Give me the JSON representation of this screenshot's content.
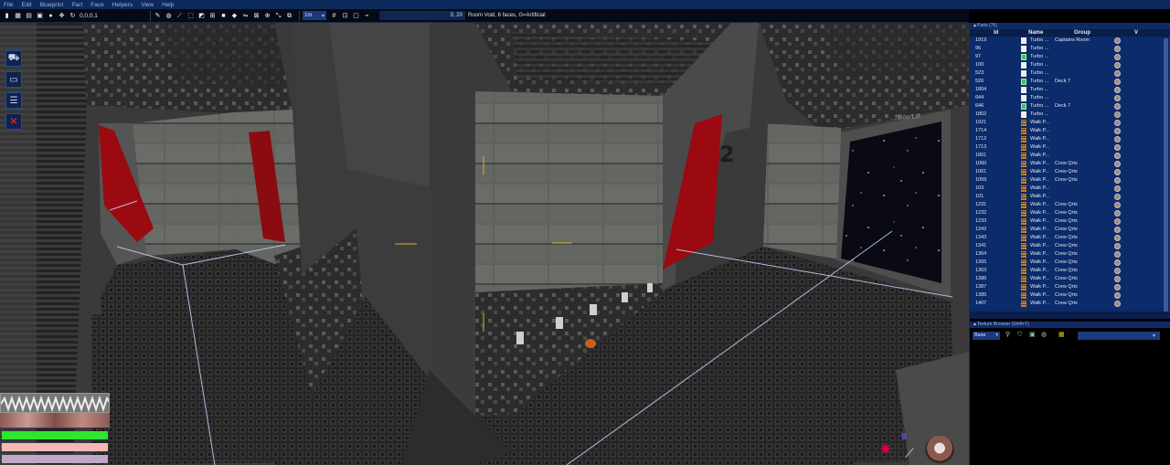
{
  "menu": [
    "File",
    "Edit",
    "Blueprint",
    "Part",
    "Face",
    "Helpers",
    "View",
    "Help"
  ],
  "toolbar": {
    "coords": "0,0,0.1",
    "unit": "1m",
    "readout": "0, 20",
    "status": "Room Void, 6 faces, G=Artificial"
  },
  "viewport": {
    "sign_label": "Turbo Lift",
    "deck_number": "2",
    "hud_number": "8"
  },
  "parts_panel": {
    "title": "Parts (76)",
    "columns": [
      "Id",
      "Name",
      "Group",
      "V"
    ],
    "rows": [
      {
        "id": "1919",
        "name": "Turbo ...",
        "group": "Captains Room",
        "icon": "turbo-white"
      },
      {
        "id": "96",
        "name": "Turbo ...",
        "group": "",
        "icon": "turbo-white"
      },
      {
        "id": "97",
        "name": "Turbo ...",
        "group": "",
        "icon": "turbo-green"
      },
      {
        "id": "100",
        "name": "Turbo ...",
        "group": "",
        "icon": "turbo-white"
      },
      {
        "id": "523",
        "name": "Turbo ...",
        "group": "",
        "icon": "turbo-white"
      },
      {
        "id": "526",
        "name": "Turbo ...",
        "group": "Deck 7",
        "icon": "turbo-green"
      },
      {
        "id": "1804",
        "name": "Turbo ...",
        "group": "",
        "icon": "turbo-white"
      },
      {
        "id": "644",
        "name": "Turbo ...",
        "group": "",
        "icon": "turbo-white"
      },
      {
        "id": "646",
        "name": "Turbo ...",
        "group": "Deck 7",
        "icon": "turbo-green"
      },
      {
        "id": "1802",
        "name": "Turbo ...",
        "group": "",
        "icon": "turbo-white"
      },
      {
        "id": "1921",
        "name": "Walk P...",
        "group": "",
        "icon": "walk"
      },
      {
        "id": "1714",
        "name": "Walk P...",
        "group": "",
        "icon": "walk"
      },
      {
        "id": "1712",
        "name": "Walk P...",
        "group": "",
        "icon": "walk"
      },
      {
        "id": "1713",
        "name": "Walk P...",
        "group": "",
        "icon": "walk"
      },
      {
        "id": "1801",
        "name": "Walk P...",
        "group": "",
        "icon": "walk"
      },
      {
        "id": "1060",
        "name": "Walk P...",
        "group": "Crew Qrts",
        "icon": "walk"
      },
      {
        "id": "1061",
        "name": "Walk P...",
        "group": "Crew Qrts",
        "icon": "walk"
      },
      {
        "id": "1059",
        "name": "Walk P...",
        "group": "Crew Qrts",
        "icon": "walk"
      },
      {
        "id": "103",
        "name": "Walk P...",
        "group": "",
        "icon": "walk"
      },
      {
        "id": "101",
        "name": "Walk P...",
        "group": "",
        "icon": "walk"
      },
      {
        "id": "1231",
        "name": "Walk P...",
        "group": "Crew Qrts",
        "icon": "walk"
      },
      {
        "id": "1232",
        "name": "Walk P...",
        "group": "Crew Qrts",
        "icon": "walk"
      },
      {
        "id": "1233",
        "name": "Walk P...",
        "group": "Crew Qrts",
        "icon": "walk"
      },
      {
        "id": "1342",
        "name": "Walk P...",
        "group": "Crew Qrts",
        "icon": "walk"
      },
      {
        "id": "1343",
        "name": "Walk P...",
        "group": "Crew Qrts",
        "icon": "walk"
      },
      {
        "id": "1341",
        "name": "Walk P...",
        "group": "Crew Qrts",
        "icon": "walk"
      },
      {
        "id": "1364",
        "name": "Walk P...",
        "group": "Crew Qrts",
        "icon": "walk"
      },
      {
        "id": "1365",
        "name": "Walk P...",
        "group": "Crew Qrts",
        "icon": "walk"
      },
      {
        "id": "1363",
        "name": "Walk P...",
        "group": "Crew Qrts",
        "icon": "walk"
      },
      {
        "id": "1386",
        "name": "Walk P...",
        "group": "Crew Qrts",
        "icon": "walk"
      },
      {
        "id": "1387",
        "name": "Walk P...",
        "group": "Crew Qrts",
        "icon": "walk"
      },
      {
        "id": "1385",
        "name": "Walk P...",
        "group": "Crew Qrts",
        "icon": "walk"
      },
      {
        "id": "1407",
        "name": "Walk P...",
        "group": "Crew Qrts",
        "icon": "walk"
      }
    ]
  },
  "texture_panel": {
    "title": "Texture Browser (Shift+T)",
    "base_select": "Base"
  },
  "colors": {
    "menubar": "#0d2a5c",
    "panel_blue": "#0b2b6a",
    "accent_red": "#9a0a10",
    "health_green": "#2ee62e"
  }
}
